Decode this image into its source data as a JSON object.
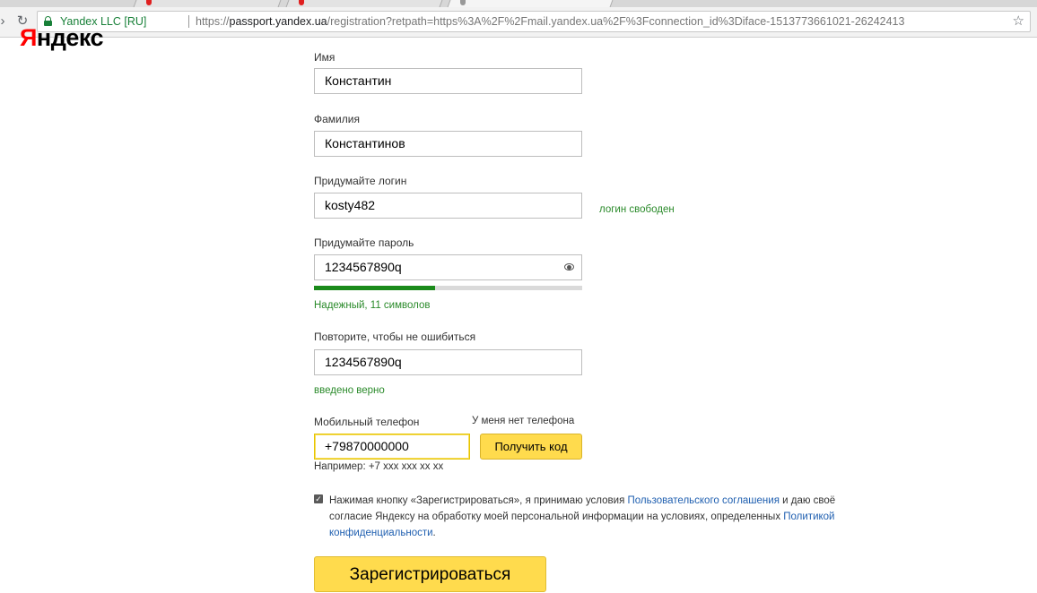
{
  "browser": {
    "site_name": "Yandex LLC [RU]",
    "url_scheme": "https://",
    "url_host": "passport.yandex.ua",
    "url_path": "/registration?retpath=https%3A%2F%2Fmail.yandex.ua%2F%3Fconnection_id%3Diface-1513773661021-26242413"
  },
  "logo": {
    "first_letter": "Я",
    "rest": "ндекс"
  },
  "form": {
    "first_name": {
      "label": "Имя",
      "value": "Константин"
    },
    "last_name": {
      "label": "Фамилия",
      "value": "Константинов"
    },
    "login": {
      "label": "Придумайте логин",
      "value": "kosty482",
      "status": "логин свободен"
    },
    "password": {
      "label": "Придумайте пароль",
      "value": "1234567890q",
      "strength_fraction": 0.45,
      "strength_text": "Надежный, 11 символов"
    },
    "password_repeat": {
      "label": "Повторите, чтобы не ошибиться",
      "value": "1234567890q",
      "status": "введено верно"
    },
    "phone": {
      "label": "Мобильный телефон",
      "no_phone_link": "У меня нет телефона",
      "value": "+79870000000",
      "get_code_button": "Получить код",
      "hint": "Например: +7 xxx xxx xx xx"
    },
    "consent": {
      "checked": true,
      "text_1": "Нажимая кнопку «Зарегистрироваться», я принимаю условия ",
      "link_1": "Пользовательского соглашения",
      "text_2": " и даю своё согласие Яндексу на обработку моей персональной информации на условиях, определенных ",
      "link_2": "Политикой конфиденциальности",
      "text_3": "."
    },
    "register_button": "Зарегистрироваться"
  },
  "colors": {
    "accent_yellow": "#ffdb4d",
    "success_green": "#2a8a2a",
    "link_blue": "#1f5fb0",
    "logo_red": "#ff0000"
  }
}
